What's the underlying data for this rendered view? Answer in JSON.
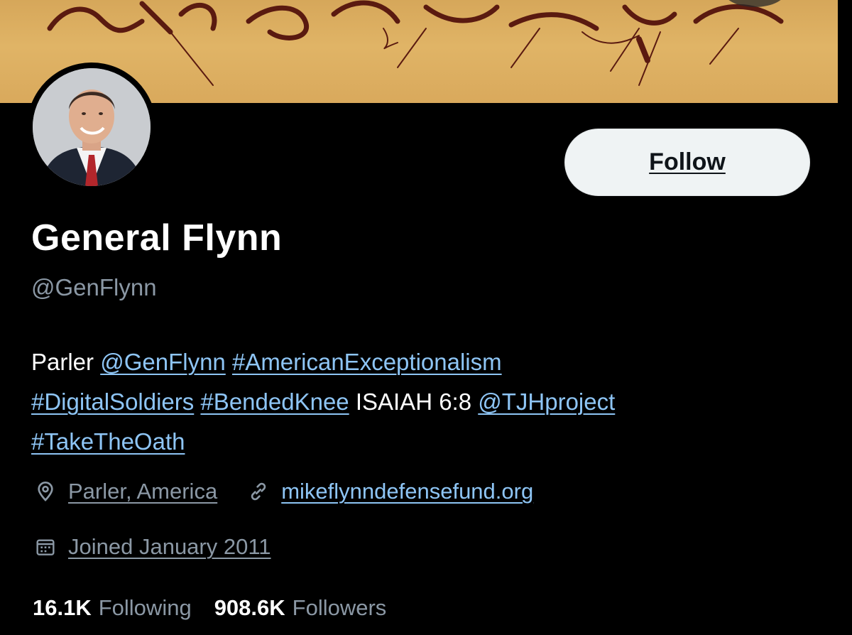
{
  "profile": {
    "display_name": "General Flynn",
    "handle": "@GenFlynn",
    "follow_label": "Follow",
    "bio": {
      "line1_prefix": "Parler ",
      "mention1": "@GenFlynn",
      "hashtag1": "#AmericanExceptionalism",
      "hashtag2": "#DigitalSoldiers",
      "hashtag3": "#BendedKnee",
      "plain_text": "ISAIAH 6:8",
      "mention2": "@TJHproject",
      "hashtag4": "#TakeTheOath"
    },
    "location": "Parler, America",
    "website": "mikeflynndefensefund.org",
    "joined": "Joined January 2011",
    "following_count": "16.1K",
    "following_label": "Following",
    "followers_count": "908.6K",
    "followers_label": "Followers"
  },
  "icons": {
    "location": "location-pin-icon",
    "website": "link-icon",
    "joined": "calendar-icon"
  },
  "colors": {
    "background": "#000000",
    "link": "#8ec5f5",
    "secondary_text": "#8b98a5",
    "follow_button_bg": "#eff3f4",
    "banner": "#d9a95c"
  }
}
